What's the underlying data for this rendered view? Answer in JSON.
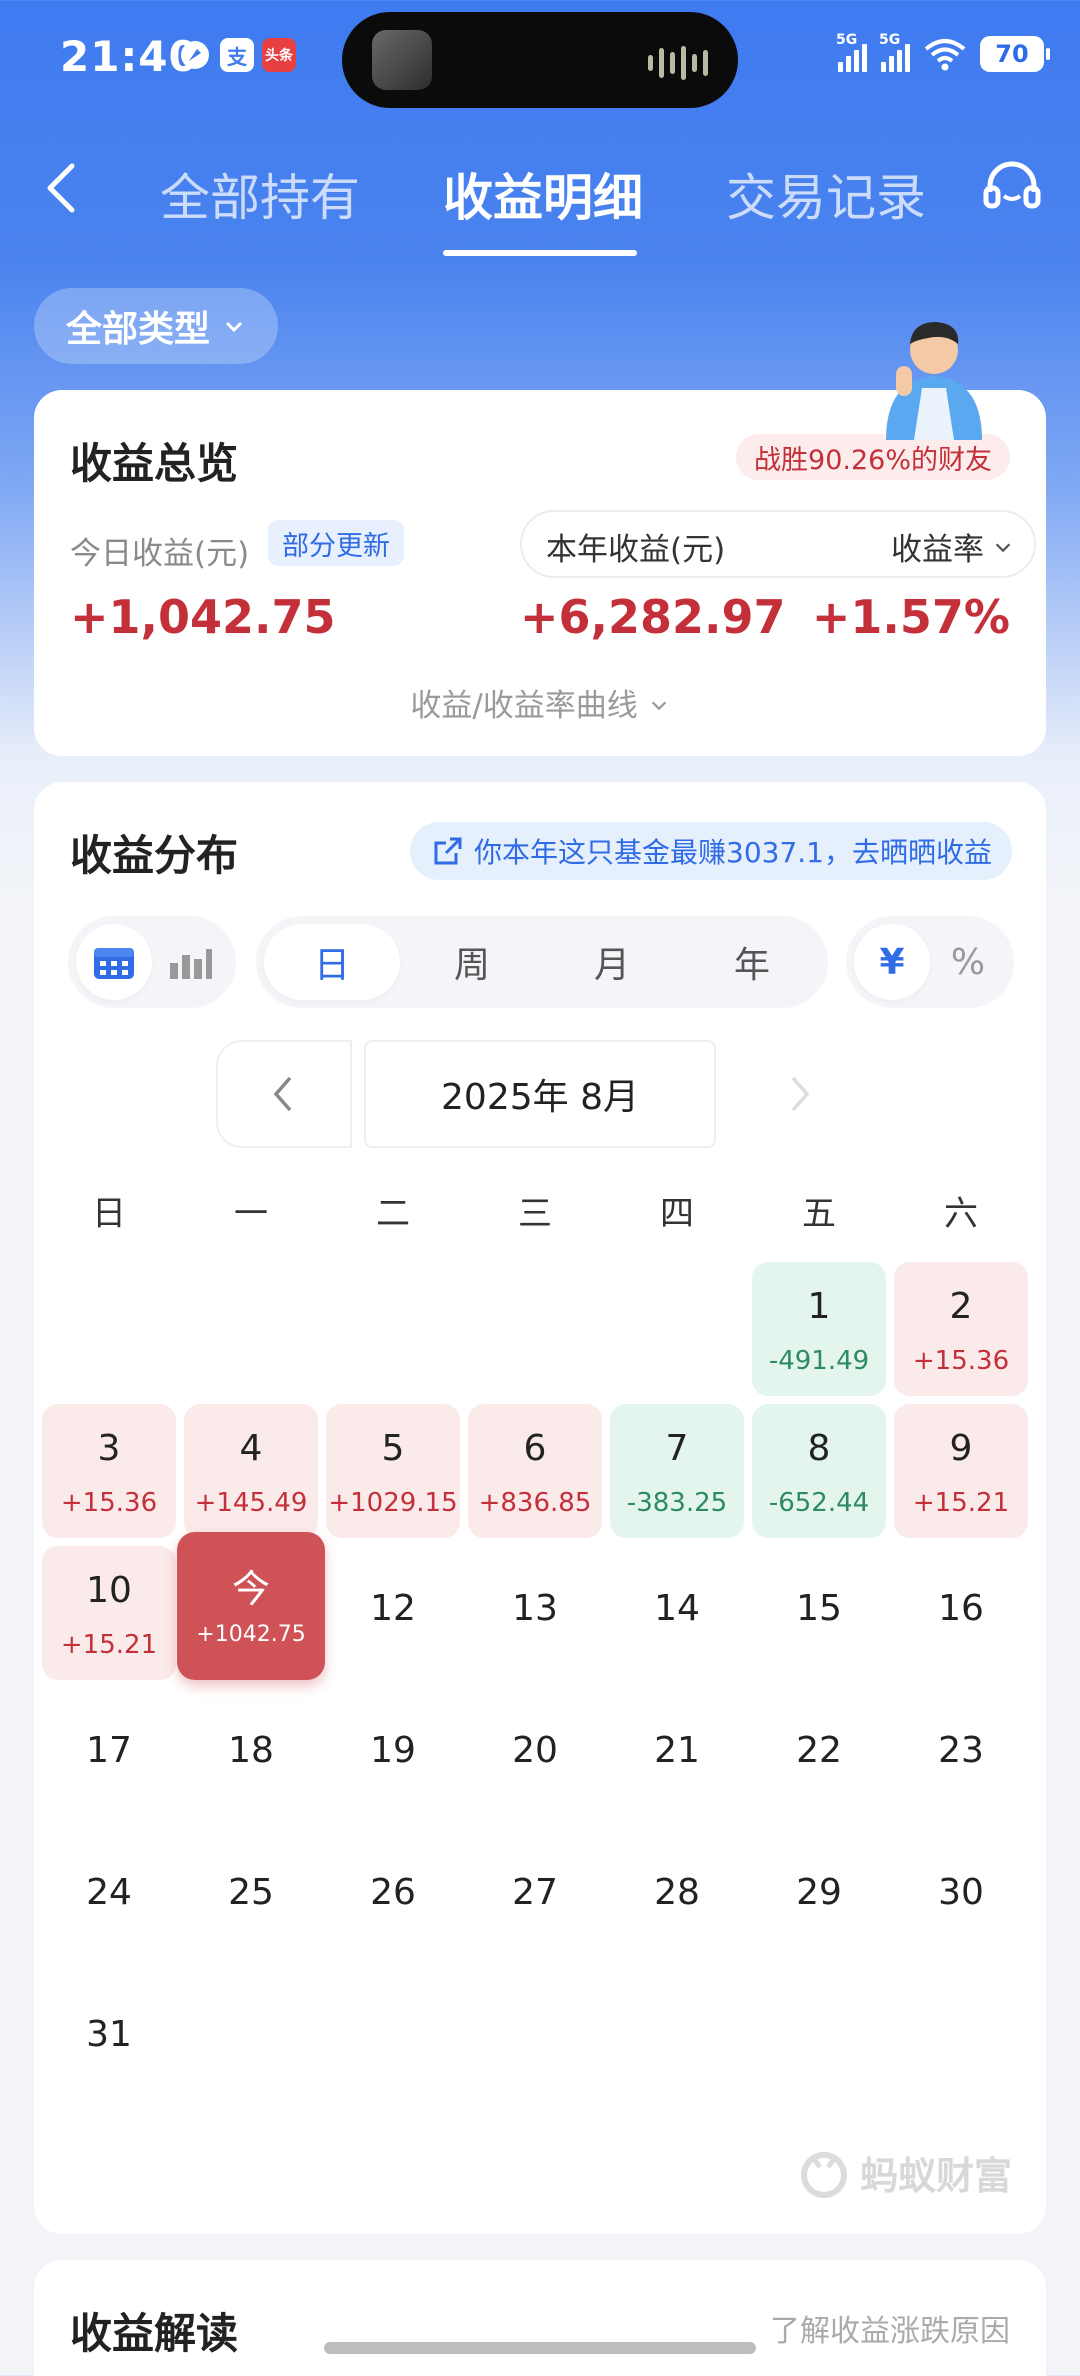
{
  "status_bar": {
    "time": "21:40",
    "app_icons": [
      "支",
      "头条"
    ],
    "network_labels": [
      "5G",
      "5G"
    ],
    "battery": "70"
  },
  "nav": {
    "tabs": [
      {
        "label": "全部持有"
      },
      {
        "label": "收益明细"
      },
      {
        "label": "交易记录"
      }
    ],
    "active_tab": "收益明细"
  },
  "filter": {
    "type_label": "全部类型"
  },
  "overview": {
    "title": "收益总览",
    "rank_badge": "战胜90.26%的财友",
    "today_label": "今日收益(元)",
    "partial_update": "部分更新",
    "today_value": "+1,042.75",
    "year_label": "本年收益(元)",
    "rate_label": "收益率",
    "year_value": "+6,282.97",
    "rate_value": "+1.57%",
    "curve_link": "收益/收益率曲线"
  },
  "distribution": {
    "title": "收益分布",
    "share_banner": "你本年这只基金最赚3037.1，去晒晒收益",
    "period_tabs": [
      "日",
      "周",
      "月",
      "年"
    ],
    "active_period": "日",
    "unit_tabs": [
      "¥",
      "%"
    ],
    "active_unit": "¥",
    "month_label": "2025年 8月",
    "weekdays": [
      "日",
      "一",
      "二",
      "三",
      "四",
      "五",
      "六"
    ],
    "days": [
      {
        "day": "1",
        "value": "-491.49"
      },
      {
        "day": "2",
        "value": "+15.36"
      },
      {
        "day": "3",
        "value": "+15.36"
      },
      {
        "day": "4",
        "value": "+145.49"
      },
      {
        "day": "5",
        "value": "+1029.15"
      },
      {
        "day": "6",
        "value": "+836.85"
      },
      {
        "day": "7",
        "value": "-383.25"
      },
      {
        "day": "8",
        "value": "-652.44"
      },
      {
        "day": "9",
        "value": "+15.21"
      },
      {
        "day": "10",
        "value": "+15.21"
      },
      {
        "day": "今",
        "value": "+1042.75"
      },
      {
        "day": "12"
      },
      {
        "day": "13"
      },
      {
        "day": "14"
      },
      {
        "day": "15"
      },
      {
        "day": "16"
      },
      {
        "day": "17"
      },
      {
        "day": "18"
      },
      {
        "day": "19"
      },
      {
        "day": "20"
      },
      {
        "day": "21"
      },
      {
        "day": "22"
      },
      {
        "day": "23"
      },
      {
        "day": "24"
      },
      {
        "day": "25"
      },
      {
        "day": "26"
      },
      {
        "day": "27"
      },
      {
        "day": "28"
      },
      {
        "day": "29"
      },
      {
        "day": "30"
      },
      {
        "day": "31"
      }
    ],
    "watermark": "蚂蚁财富"
  },
  "interpretation": {
    "title": "收益解读",
    "link": "了解收益涨跌原因"
  },
  "colors": {
    "brand_blue": "#2F6CE6",
    "gain_red": "#C4303A",
    "loss_green": "#2E8A63",
    "today_red": "#CF5257"
  }
}
